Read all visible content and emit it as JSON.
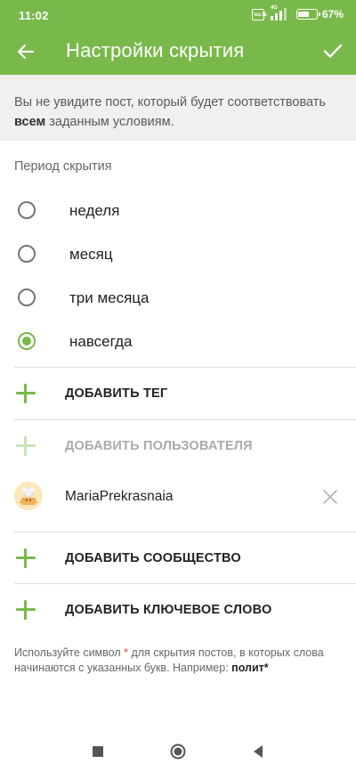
{
  "status": {
    "time": "11:02",
    "volte_label": "VoLTE",
    "network": "4G",
    "battery_percent": 67,
    "battery_label": "67%"
  },
  "appbar": {
    "title": "Настройки скрытия",
    "back_icon": "arrow-left-icon",
    "confirm_icon": "check-icon"
  },
  "info": {
    "before": "Вы не увидите пост, который будет соответствовать ",
    "bold": "всем",
    "after": " заданным условиям."
  },
  "period": {
    "title": "Период скрытия",
    "options": [
      {
        "label": "неделя",
        "checked": false
      },
      {
        "label": "месяц",
        "checked": false
      },
      {
        "label": "три месяца",
        "checked": false
      },
      {
        "label": "навсегда",
        "checked": true
      }
    ]
  },
  "actions": {
    "add_tag": "ДОБАВИТЬ ТЕГ",
    "add_user": "ДОБАВИТЬ ПОЛЬЗОВАТЕЛЯ",
    "add_community": "ДОБАВИТЬ СООБЩЕСТВО",
    "add_keyword": "ДОБАВИТЬ КЛЮЧЕВОЕ СЛОВО"
  },
  "user": {
    "name": "MariaPrekrasnaia",
    "remove_icon": "close-icon"
  },
  "hint": {
    "before": "Используйте символ ",
    "star": "*",
    "middle": " для скрытия постов, в которых слова начинаются с указанных букв. Например: ",
    "example": "полит*"
  },
  "colors": {
    "accent": "#79b84a",
    "star": "#e04a3a"
  }
}
